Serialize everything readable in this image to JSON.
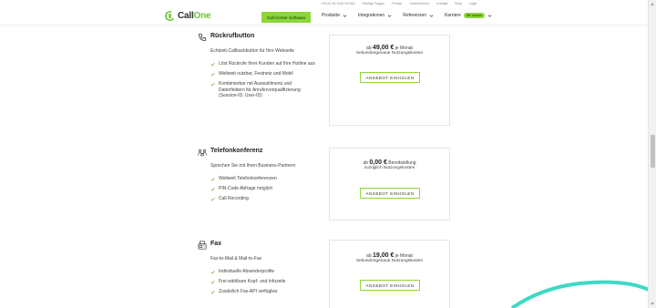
{
  "topbar": {
    "phone": "+49 (0) 30 1000 53 900",
    "links": [
      "Häufige Fragen",
      "Presse",
      "Unternehmen",
      "Kontakt",
      "Blog",
      "Login"
    ]
  },
  "brand": {
    "name_part1": "Call",
    "name_part2": "One"
  },
  "header": {
    "cta_label": "Call Center Software",
    "nav": [
      {
        "label": "Produkte"
      },
      {
        "label": "Integrationen"
      },
      {
        "label": "Referenzen"
      },
      {
        "label": "Karriere",
        "badge": "Wir suchen"
      }
    ]
  },
  "features": [
    {
      "title": "Rückrufbutton",
      "icon": "phone-callback-icon",
      "subtitle": "Echtzeit-Callbackbutton für Ihre Webseite",
      "bullets": [
        "Löst Rückrufe Ihrer Kunden auf Ihre Hotline aus",
        "Weltweit nutzbar, Festnetz und Mobil",
        "Kombinierbar mit Auswahlmenü und Datenfeldern für Anrufervorqualifizierung (Session-ID, User-ID)"
      ],
      "price_prefix": "ab",
      "price": "49,00 €",
      "price_suffix": "je Monat",
      "price_note": "Sekundengenaue Nutzungskosten",
      "button": "ANGEBOT EINHOLEN"
    },
    {
      "title": "Telefonkonferenz",
      "icon": "conference-icon",
      "subtitle": "Sprechen Sie mit Ihren Business-Partnern",
      "bullets": [
        "Weltweit Telefonkonferenzen",
        "PIN-Code Abfrage möglich",
        "Call Recording"
      ],
      "price_prefix": "ab",
      "price": "0,00 €",
      "price_suffix": "Bereitstellung",
      "price_note": "zuzüglich Nutzungskosten",
      "button": "ANGEBOT EINHOLEN"
    },
    {
      "title": "Fax",
      "icon": "fax-icon",
      "subtitle": "Fax-to-Mail & Mail-to-Fax",
      "bullets": [
        "Individuelle Absenderprofile",
        "Frei wählbare Kopf- und Infozeile",
        "Zusätzlich Fax-API verfügbar"
      ],
      "price_prefix": "ab",
      "price": "19,00 €",
      "price_suffix": "je Monat",
      "price_note": "Sekundengenaue Nutzungskosten",
      "button": "ANGEBOT EINHOLEN"
    }
  ],
  "colors": {
    "accent": "#8cd63a",
    "brand_green": "#6bc43a",
    "swoosh": "#3fd9c4"
  }
}
